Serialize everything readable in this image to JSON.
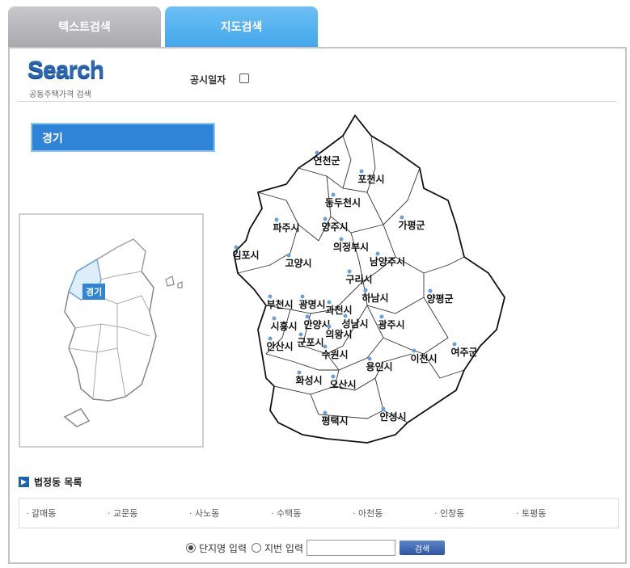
{
  "tabs": [
    {
      "label": "텍스트검색"
    },
    {
      "label": "지도검색"
    }
  ],
  "header": {
    "logo": "Search",
    "logo_sub": "공동주택가격 검색",
    "date_label": "공시일자"
  },
  "region": {
    "selected": "경기"
  },
  "korea_map": {
    "label": "경기"
  },
  "cities": [
    "연천군",
    "포천시",
    "동두천시",
    "가평군",
    "파주시",
    "양주시",
    "의정부시",
    "김포시",
    "고양시",
    "남양주시",
    "구리시",
    "하남시",
    "양평군",
    "부천시",
    "광명시",
    "과천시",
    "시흥시",
    "안양시",
    "성남시",
    "광주시",
    "의왕시",
    "군포시",
    "안산시",
    "수원시",
    "이천시",
    "여주군",
    "용인시",
    "화성시",
    "오산시",
    "평택시",
    "안성시"
  ],
  "dong_list": {
    "title": "법정동 목록",
    "items": [
      "갈매동",
      "교문동",
      "사노동",
      "수택동",
      "아천동",
      "인창동",
      "토평동"
    ]
  },
  "search": {
    "option1": "단지명 입력",
    "option2": "지번 입력",
    "button": "검색"
  },
  "colors": {
    "accent": "#2f84d8",
    "tab_active": "#55b0ef",
    "logo": "#2b67b3"
  }
}
